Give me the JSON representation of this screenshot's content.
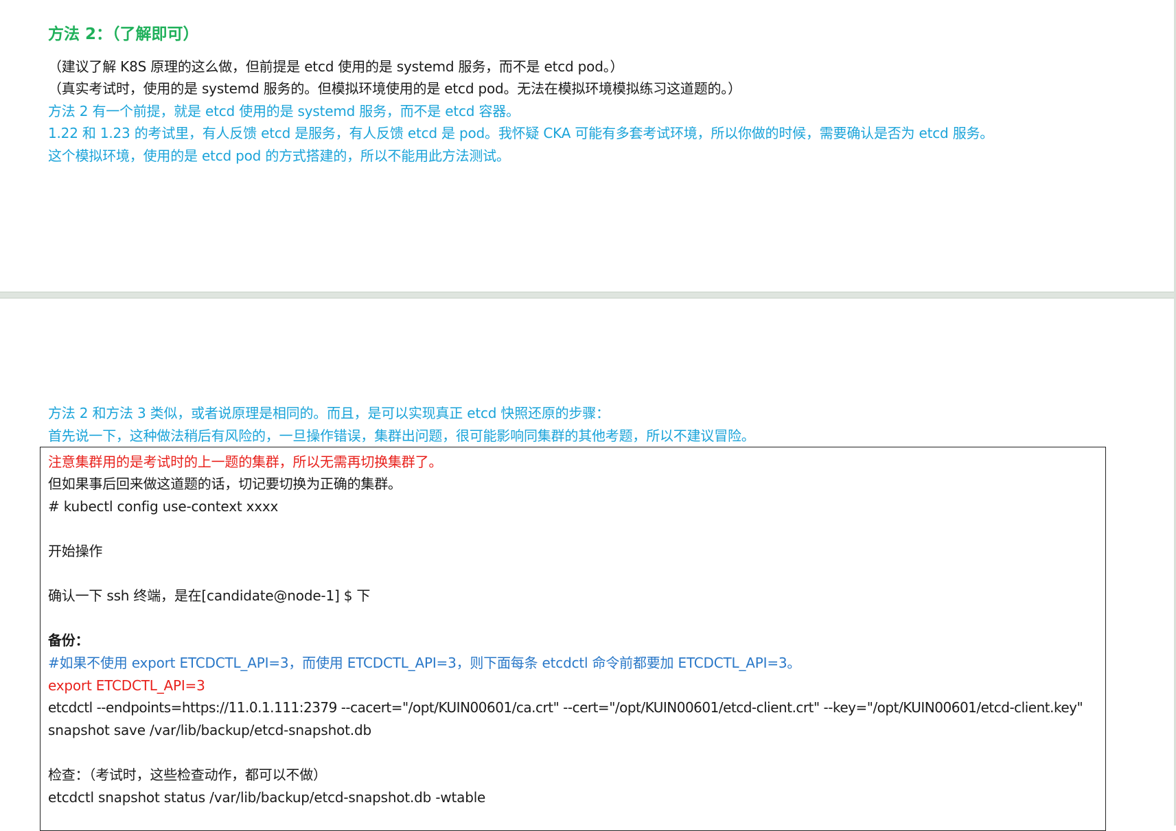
{
  "top_section": {
    "heading": "方法 2：（了解即可）",
    "lines": [
      "（建议了解 K8S 原理的这么做，但前提是 etcd 使用的是 systemd 服务，而不是 etcd pod。）",
      "（真实考试时，使用的是 systemd 服务的。但模拟环境使用的是 etcd pod。无法在模拟环境模拟练习这道题的。）",
      "方法 2 有一个前提，就是 etcd 使用的是 systemd 服务，而不是 etcd 容器。",
      "1.22 和 1.23 的考试里，有人反馈 etcd 是服务，有人反馈 etcd 是 pod。我怀疑 CKA 可能有多套考试环境，所以你做的时候，需要确认是否为 etcd 服务。",
      "这个模拟环境，使用的是 etcd pod 的方式搭建的，所以不能用此方法测试。"
    ]
  },
  "bottom_section": {
    "intro_lines": [
      "方法 2 和方法 3 类似，或者说原理是相同的。而且，是可以实现真正 etcd 快照还原的步骤：",
      "首先说一下，这种做法稍后有风险的，一旦操作错误，集群出问题，很可能影响同集群的其他考题，所以不建议冒险。"
    ],
    "box": {
      "warning": "注意集群用的是考试时的上一题的集群，所以无需再切换集群了。",
      "note": "但如果事后回来做这道题的话，切记要切换为正确的集群。",
      "context_cmd": "# kubectl config use-context xxxx",
      "start_label": "开始操作",
      "ssh_check": "确认一下 ssh 终端，是在[candidate@node-1] $  下",
      "backup_label": "备份：",
      "api_comment": "#如果不使用 export ETCDCTL_API=3，而使用 ETCDCTL_API=3，则下面每条 etcdctl 命令前都要加 ETCDCTL_API=3。",
      "export_cmd": "export ETCDCTL_API=3",
      "snapshot_cmd_1": "etcdctl --endpoints=https://11.0.1.111:2379 --cacert=\"/opt/KUIN00601/ca.crt\" --cert=\"/opt/KUIN00601/etcd-client.crt\" --key=\"/opt/KUIN00601/etcd-client.key\"",
      "snapshot_cmd_2": "snapshot save /var/lib/backup/etcd-snapshot.db",
      "check_label": "检查：（考试时，这些检查动作，都可以不做）",
      "status_cmd": "etcdctl snapshot status /var/lib/backup/etcd-snapshot.db -wtable"
    }
  },
  "colors": {
    "heading_green": "#1fb05a",
    "note_blue": "#1aa3d9",
    "command_blue": "#2a78c8",
    "warning_red": "#e8211c",
    "text_black": "#1a1a1a"
  }
}
